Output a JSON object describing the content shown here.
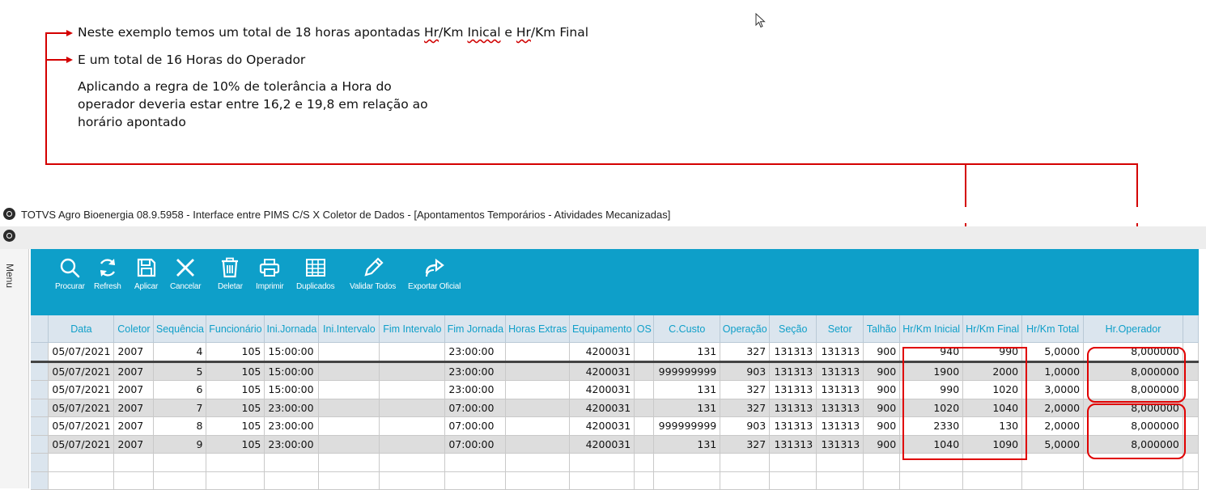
{
  "annotations": {
    "line1_before": "Neste exemplo temos um total de 18 horas apontadas ",
    "line1_hr1": "Hr",
    "line1_km1": "/Km ",
    "line1_inical": "Inical",
    "line1_mid": " e ",
    "line1_hr2": "Hr",
    "line1_km2": "/Km Final",
    "line2": "E um total de 16 Horas do Operador",
    "line3": "Aplicando a regra de 10% de tolerância a Hora do operador deveria estar entre 16,2 e 19,8 em relação ao horário apontado"
  },
  "window": {
    "title": "TOTVS Agro Bioenergia 08.9.5958 - Interface entre PIMS C/S X Coletor de Dados - [Apontamentos Temporários - Atividades Mecanizadas]",
    "menu_label": "Menu"
  },
  "toolbar": {
    "procurar": "Procurar",
    "refresh": "Refresh",
    "aplicar": "Aplicar",
    "cancelar": "Cancelar",
    "deletar": "Deletar",
    "imprimir": "Imprimir",
    "duplicados": "Duplicados",
    "validar": "Validar Todos",
    "exportar": "Exportar Oficial"
  },
  "grid": {
    "columns": [
      "Data",
      "Coletor",
      "Sequência",
      "Funcionário",
      "Ini.Jornada",
      "Ini.Intervalo",
      "Fim Intervalo",
      "Fim Jornada",
      "Horas Extras",
      "Equipamento",
      "OS",
      "C.Custo",
      "Operação",
      "Seção",
      "Setor",
      "Talhão",
      "Hr/Km Inicial",
      "Hr/Km Final",
      "Hr/Km Total",
      "Hr.Operador"
    ],
    "rows": [
      [
        "05/07/2021",
        "2007",
        "4",
        "105",
        "15:00:00",
        "",
        "",
        "23:00:00",
        "",
        "4200031",
        "",
        "131",
        "327",
        "131313",
        "131313",
        "900",
        "940",
        "990",
        "5,0000",
        "8,000000"
      ],
      [
        "05/07/2021",
        "2007",
        "5",
        "105",
        "15:00:00",
        "",
        "",
        "23:00:00",
        "",
        "4200031",
        "",
        "999999999",
        "903",
        "131313",
        "131313",
        "900",
        "1900",
        "2000",
        "1,0000",
        "8,000000"
      ],
      [
        "05/07/2021",
        "2007",
        "6",
        "105",
        "15:00:00",
        "",
        "",
        "23:00:00",
        "",
        "4200031",
        "",
        "131",
        "327",
        "131313",
        "131313",
        "900",
        "990",
        "1020",
        "3,0000",
        "8,000000"
      ],
      [
        "05/07/2021",
        "2007",
        "7",
        "105",
        "23:00:00",
        "",
        "",
        "07:00:00",
        "",
        "4200031",
        "",
        "131",
        "327",
        "131313",
        "131313",
        "900",
        "1020",
        "1040",
        "2,0000",
        "8,000000"
      ],
      [
        "05/07/2021",
        "2007",
        "8",
        "105",
        "23:00:00",
        "",
        "",
        "07:00:00",
        "",
        "4200031",
        "",
        "999999999",
        "903",
        "131313",
        "131313",
        "900",
        "2330",
        "130",
        "2,0000",
        "8,000000"
      ],
      [
        "05/07/2021",
        "2007",
        "9",
        "105",
        "23:00:00",
        "",
        "",
        "07:00:00",
        "",
        "4200031",
        "",
        "131",
        "327",
        "131313",
        "131313",
        "900",
        "1040",
        "1090",
        "5,0000",
        "8,000000"
      ]
    ]
  },
  "colors": {
    "toolbar_bg": "#0e9fc9",
    "header_text": "#0f9fc9",
    "highlight": "#e00000"
  }
}
